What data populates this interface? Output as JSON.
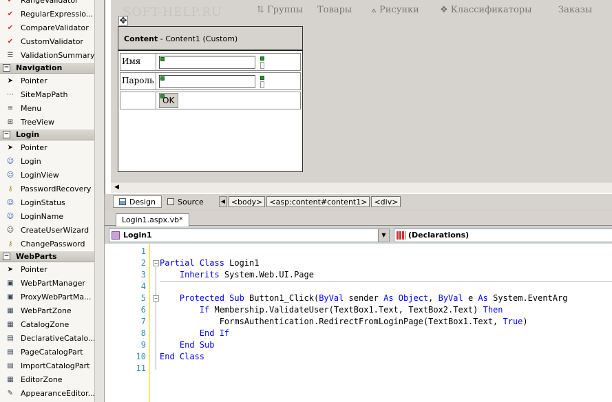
{
  "toolbox": {
    "groups": [
      {
        "header": null,
        "items": [
          {
            "label": "RangeValidator",
            "icon": "validator-icon"
          },
          {
            "label": "RegularExpressio...",
            "icon": "validator-icon"
          },
          {
            "label": "CompareValidator",
            "icon": "validator-icon"
          },
          {
            "label": "CustomValidator",
            "icon": "validator-icon"
          },
          {
            "label": "ValidationSummary",
            "icon": "summary-icon"
          }
        ]
      },
      {
        "header": "Navigation",
        "items": [
          {
            "label": "Pointer",
            "icon": "pointer-icon"
          },
          {
            "label": "SiteMapPath",
            "icon": "sitemap-icon"
          },
          {
            "label": "Menu",
            "icon": "menu-icon"
          },
          {
            "label": "TreeView",
            "icon": "tree-icon"
          }
        ]
      },
      {
        "header": "Login",
        "items": [
          {
            "label": "Pointer",
            "icon": "pointer-icon"
          },
          {
            "label": "Login",
            "icon": "login-icon"
          },
          {
            "label": "LoginView",
            "icon": "login-icon"
          },
          {
            "label": "PasswordRecovery",
            "icon": "key-icon"
          },
          {
            "label": "LoginStatus",
            "icon": "login-icon"
          },
          {
            "label": "LoginName",
            "icon": "login-icon"
          },
          {
            "label": "CreateUserWizard",
            "icon": "user-add-icon"
          },
          {
            "label": "ChangePassword",
            "icon": "key-icon"
          }
        ]
      },
      {
        "header": "WebParts",
        "items": [
          {
            "label": "Pointer",
            "icon": "pointer-icon"
          },
          {
            "label": "WebPartManager",
            "icon": "webpart-icon"
          },
          {
            "label": "ProxyWebPartMa...",
            "icon": "webpart-icon"
          },
          {
            "label": "WebPartZone",
            "icon": "zone-icon"
          },
          {
            "label": "CatalogZone",
            "icon": "zone-icon"
          },
          {
            "label": "DeclarativeCatalo...",
            "icon": "catalog-icon"
          },
          {
            "label": "PageCatalogPart",
            "icon": "catalog-icon"
          },
          {
            "label": "ImportCatalogPart",
            "icon": "catalog-icon"
          },
          {
            "label": "EditorZone",
            "icon": "zone-icon"
          },
          {
            "label": "AppearanceEditor...",
            "icon": "editor-icon"
          }
        ]
      }
    ]
  },
  "designer": {
    "master_ghost": "SOFT-HELP.RU",
    "master_nav": [
      "Группы",
      "Товары",
      "Рисунки",
      "Классификаторы",
      "Заказы"
    ],
    "content_title_bold": "Content",
    "content_title_rest": " - Content1 (Custom)",
    "label_name": "Имя",
    "label_password": "Пароль",
    "ok_button": "OK"
  },
  "view_bar": {
    "design": "Design",
    "source": "Source",
    "breadcrumbs": [
      "<body>",
      "<asp:content#content1>",
      "<div>"
    ]
  },
  "editor": {
    "file_tab": "Login1.aspx.vb*",
    "class_combo": "Login1",
    "member_combo": "(Declarations)",
    "lines": [
      {
        "n": "1",
        "parts": []
      },
      {
        "n": "2",
        "parts": [
          {
            "t": "Partial Class",
            "k": 1
          },
          {
            "t": " Login1",
            "k": 0
          }
        ]
      },
      {
        "n": "3",
        "parts": [
          {
            "t": "    Inherits",
            "k": 1
          },
          {
            "t": " System.Web.UI.Page",
            "k": 0
          }
        ]
      },
      {
        "n": "4",
        "parts": []
      },
      {
        "n": "5",
        "parts": [
          {
            "t": "    Protected Sub",
            "k": 1
          },
          {
            "t": " Button1_Click(",
            "k": 0
          },
          {
            "t": "ByVal",
            "k": 1
          },
          {
            "t": " sender ",
            "k": 0
          },
          {
            "t": "As Object",
            "k": 1
          },
          {
            "t": ", ",
            "k": 0
          },
          {
            "t": "ByVal",
            "k": 1
          },
          {
            "t": " e ",
            "k": 0
          },
          {
            "t": "As",
            "k": 1
          },
          {
            "t": " System.EventArg",
            "k": 0
          }
        ]
      },
      {
        "n": "6",
        "parts": [
          {
            "t": "        If",
            "k": 1
          },
          {
            "t": " Membership.ValidateUser(TextBox1.Text, TextBox2.Text) ",
            "k": 0
          },
          {
            "t": "Then",
            "k": 1
          }
        ]
      },
      {
        "n": "7",
        "parts": [
          {
            "t": "            FormsAuthentication.RedirectFromLoginPage(TextBox1.Text, ",
            "k": 0
          },
          {
            "t": "True",
            "k": 1
          },
          {
            "t": ")",
            "k": 0
          }
        ]
      },
      {
        "n": "8",
        "parts": [
          {
            "t": "        End If",
            "k": 1
          }
        ]
      },
      {
        "n": "9",
        "parts": [
          {
            "t": "    End Sub",
            "k": 1
          }
        ]
      },
      {
        "n": "10",
        "parts": [
          {
            "t": "End Class",
            "k": 1
          }
        ]
      },
      {
        "n": "11",
        "parts": []
      }
    ]
  }
}
